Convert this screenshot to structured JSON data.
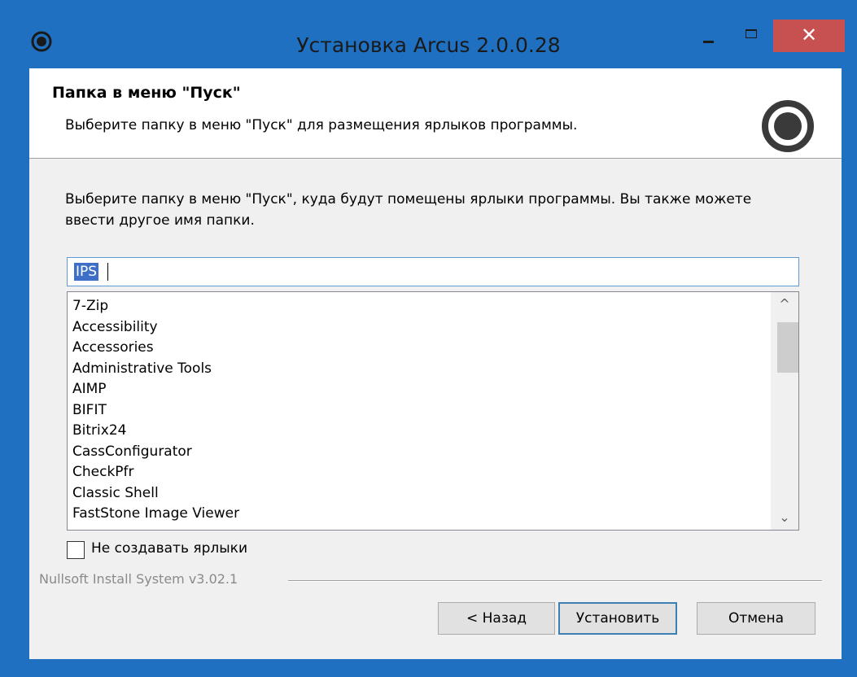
{
  "window": {
    "title": "Установка Arcus 2.0.0.28",
    "controls": {
      "minimize_icon": "minimize-icon",
      "maximize_icon": "maximize-icon",
      "close_icon": "close-icon",
      "close_glyph": "✕"
    },
    "accent_color": "#1f70c1",
    "close_color": "#c75050"
  },
  "header": {
    "title": "Папка в меню \"Пуск\"",
    "subtitle": "Выберите папку в меню \"Пуск\" для размещения ярлыков программы.",
    "icon": "arcus-logo-icon"
  },
  "main": {
    "intro": "Выберите папку в меню \"Пуск\", куда будут помещены ярлыки программы. Вы также можете ввести другое имя папки.",
    "folder_input": {
      "value": "IPS"
    },
    "folder_list": {
      "items": [
        "7-Zip",
        "Accessibility",
        "Accessories",
        "Administrative Tools",
        "AIMP",
        "BIFIT",
        "Bitrix24",
        "CassConfigurator",
        "CheckPfr",
        "Classic Shell",
        "FastStone Image Viewer"
      ],
      "scroll_up_glyph": "^",
      "scroll_down_glyph": "⌄"
    },
    "no_shortcuts": {
      "label": "Не создавать ярлыки",
      "checked": false
    }
  },
  "footer": {
    "branding": "Nullsoft Install System v3.02.1",
    "buttons": {
      "back": "< Назад",
      "install": "Установить",
      "cancel": "Отмена"
    }
  }
}
